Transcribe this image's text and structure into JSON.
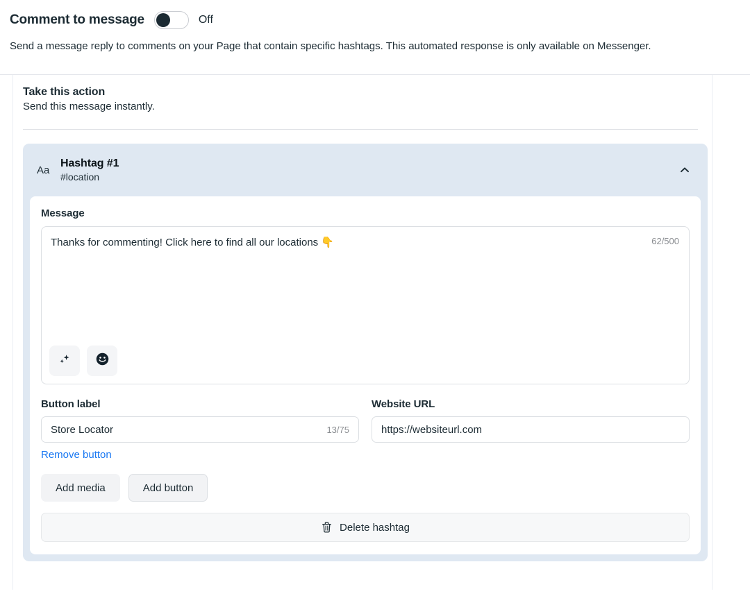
{
  "header": {
    "title": "Comment to message",
    "toggle": {
      "name": "comment-to-message-toggle",
      "state_label": "Off",
      "on": false
    },
    "description": "Send a message reply to comments on your Page that contain specific hashtags. This automated response is only available on Messenger."
  },
  "action_section": {
    "title": "Take this action",
    "subtitle": "Send this message instantly."
  },
  "hashtag_card": {
    "type_icon_label": "Aa",
    "name": "Hashtag #1",
    "tag": "#location",
    "collapse_icon": "chevron-up-icon",
    "message": {
      "label": "Message",
      "value": "Thanks for commenting! Click here to find all our locations 👇",
      "counter": "62/500",
      "tools": [
        {
          "icon": "sparkles-icon",
          "name": "ai-suggest-button"
        },
        {
          "icon": "emoji-icon",
          "name": "emoji-picker-button"
        }
      ]
    },
    "button_label": {
      "label": "Button label",
      "value": "Store Locator",
      "counter": "13/75",
      "remove_link": "Remove button"
    },
    "website_url": {
      "label": "Website URL",
      "value": "https://websiteurl.com",
      "placeholder": "https://websiteurl.com"
    },
    "actions": [
      {
        "label": "Add media",
        "name": "add-media-button"
      },
      {
        "label": "Add button",
        "name": "add-button-button"
      }
    ],
    "delete": {
      "label": "Delete hashtag",
      "icon": "trash-icon"
    }
  },
  "colors": {
    "accent_blue": "#1877f2",
    "card_blue": "#dfe8f2",
    "text": "#1c2b33",
    "muted": "#8a8d91"
  }
}
